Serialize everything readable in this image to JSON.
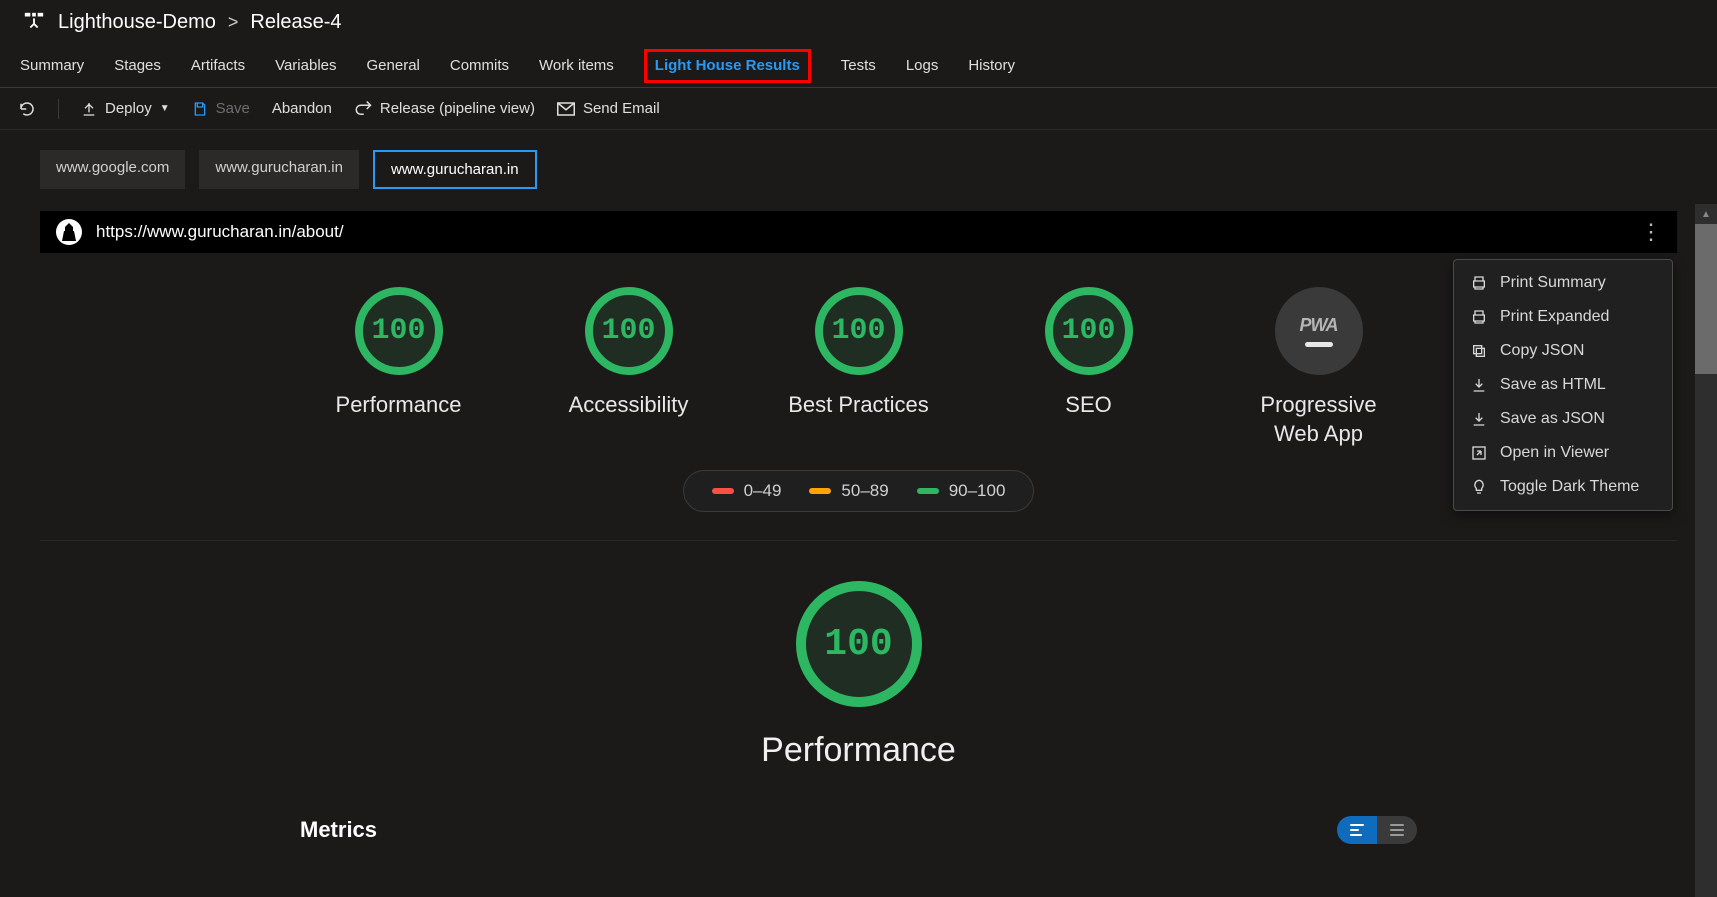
{
  "breadcrumb": {
    "project": "Lighthouse-Demo",
    "release": "Release-4"
  },
  "nav": {
    "items": [
      "Summary",
      "Stages",
      "Artifacts",
      "Variables",
      "General",
      "Commits",
      "Work items",
      "Light House Results",
      "Tests",
      "Logs",
      "History"
    ],
    "activeIndex": 7
  },
  "toolbar": {
    "deploy": "Deploy",
    "save": "Save",
    "abandon": "Abandon",
    "releaseView": "Release (pipeline view)",
    "sendEmail": "Send Email"
  },
  "urlTabs": {
    "items": [
      "www.google.com",
      "www.gurucharan.in",
      "www.gurucharan.in"
    ],
    "activeIndex": 2
  },
  "report": {
    "url": "https://www.gurucharan.in/about/",
    "gauges": [
      {
        "score": "100",
        "label": "Performance"
      },
      {
        "score": "100",
        "label": "Accessibility"
      },
      {
        "score": "100",
        "label": "Best Practices"
      },
      {
        "score": "100",
        "label": "SEO"
      }
    ],
    "pwa": {
      "label": "Progressive Web App",
      "badge": "PWA"
    },
    "legend": {
      "fail": "0–49",
      "avg": "50–89",
      "pass": "90–100"
    },
    "big": {
      "score": "100",
      "title": "Performance"
    },
    "metricsTitle": "Metrics"
  },
  "menu": {
    "items": [
      {
        "icon": "print",
        "label": "Print Summary"
      },
      {
        "icon": "print",
        "label": "Print Expanded"
      },
      {
        "icon": "copy",
        "label": "Copy JSON"
      },
      {
        "icon": "dl",
        "label": "Save as HTML"
      },
      {
        "icon": "dl",
        "label": "Save as JSON"
      },
      {
        "icon": "open",
        "label": "Open in Viewer"
      },
      {
        "icon": "bulb",
        "label": "Toggle Dark Theme"
      }
    ]
  },
  "chart_data": {
    "type": "bar",
    "title": "Lighthouse Category Scores",
    "categories": [
      "Performance",
      "Accessibility",
      "Best Practices",
      "SEO"
    ],
    "values": [
      100,
      100,
      100,
      100
    ],
    "ylim": [
      0,
      100
    ],
    "legend_ranges": [
      {
        "name": "fail",
        "min": 0,
        "max": 49,
        "color": "#ff4e42"
      },
      {
        "name": "average",
        "min": 50,
        "max": 89,
        "color": "#ffa400"
      },
      {
        "name": "pass",
        "min": 90,
        "max": 100,
        "color": "#2db762"
      }
    ]
  }
}
